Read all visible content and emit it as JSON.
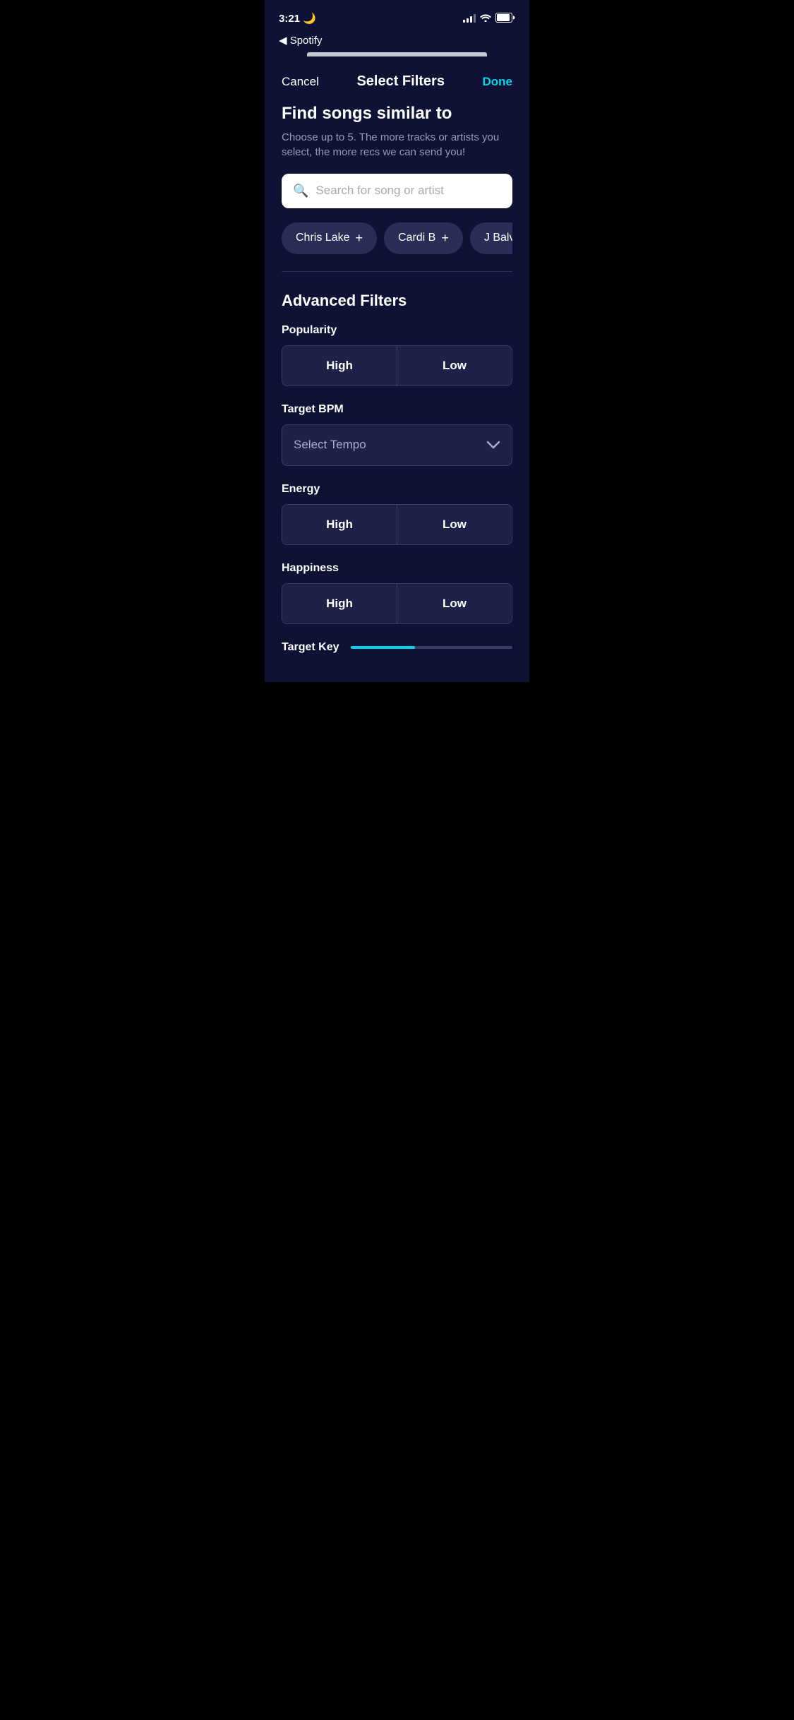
{
  "statusBar": {
    "time": "3:21",
    "moonIcon": "🌙",
    "backLabel": "◀ Spotify"
  },
  "header": {
    "cancelLabel": "Cancel",
    "title": "Select Filters",
    "doneLabel": "Done"
  },
  "findSongs": {
    "title": "Find songs similar to",
    "subtitle": "Choose up to 5. The more tracks or artists you select, the more recs we can send you!",
    "searchPlaceholder": "Search for song or artist"
  },
  "chips": [
    {
      "label": "Chris Lake",
      "showPlus": true
    },
    {
      "label": "Cardi B",
      "showPlus": true
    },
    {
      "label": "J Balvin",
      "showPlus": true
    }
  ],
  "advancedFilters": {
    "sectionTitle": "Advanced Filters",
    "filters": [
      {
        "id": "popularity",
        "label": "Popularity",
        "type": "toggle",
        "options": [
          "High",
          "Low"
        ]
      },
      {
        "id": "targetBpm",
        "label": "Target BPM",
        "type": "dropdown",
        "placeholder": "Select Tempo"
      },
      {
        "id": "energy",
        "label": "Energy",
        "type": "toggle",
        "options": [
          "High",
          "Low"
        ]
      },
      {
        "id": "happiness",
        "label": "Happiness",
        "type": "toggle",
        "options": [
          "High",
          "Low"
        ]
      }
    ],
    "targetKey": {
      "label": "Target Key"
    }
  },
  "icons": {
    "search": "🔍",
    "chevronDown": "⌄",
    "moon": "🌙"
  },
  "colors": {
    "accent": "#00d4e8",
    "background": "#0f1235",
    "cardBg": "#1e2148",
    "chipBg": "#2a2d55",
    "border": "#3a3d65",
    "textPrimary": "#ffffff",
    "textSecondary": "#9999bb",
    "textMuted": "#aaaacc"
  }
}
